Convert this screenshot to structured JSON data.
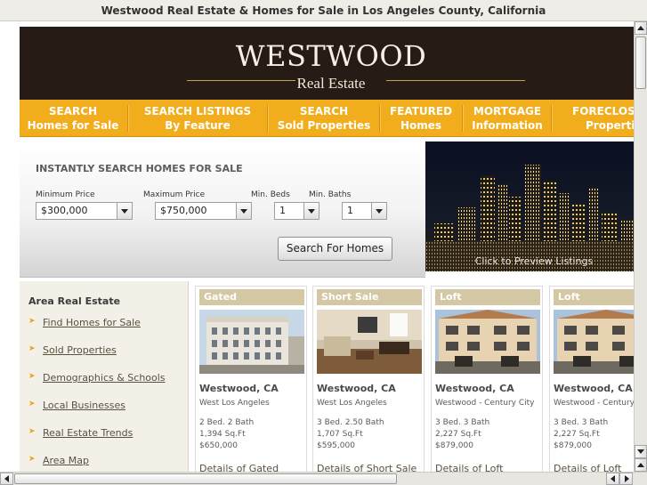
{
  "window": {
    "title": "Westwood Real Estate & Homes for Sale in Los Angeles County, California"
  },
  "header": {
    "logo_title": "WESTWOOD",
    "logo_subtitle": "Real Estate"
  },
  "nav": [
    {
      "line1": "SEARCH",
      "line2": "Homes for Sale"
    },
    {
      "line1": "SEARCH LISTINGS",
      "line2": "By Feature"
    },
    {
      "line1": "SEARCH",
      "line2": "Sold Properties"
    },
    {
      "line1": "FEATURED",
      "line2": "Homes"
    },
    {
      "line1": "MORTGAGE",
      "line2": "Information"
    },
    {
      "line1": "FORECLOSU",
      "line2": "Properties"
    }
  ],
  "search": {
    "heading": "INSTANTLY SEARCH HOMES FOR SALE",
    "min_price_label": "Minimum Price",
    "min_price_value": "$300,000",
    "max_price_label": "Maximum Price",
    "max_price_value": "$750,000",
    "beds_label": "Min. Beds",
    "beds_value": "1",
    "baths_label": "Min. Baths",
    "baths_value": "1",
    "button": "Search For Homes"
  },
  "city_photo": {
    "caption": "Click to Preview Listings"
  },
  "sidebar": {
    "heading": "Area Real Estate",
    "arrow": "➤",
    "items": [
      "Find Homes for Sale",
      "Sold Properties",
      "Demographics & Schools",
      "Local Businesses",
      "Real Estate Trends",
      "Area Map"
    ]
  },
  "listings": [
    {
      "tag": "Gated",
      "location": "Westwood, CA",
      "area": "West Los Angeles",
      "beds_baths": "2 Bed. 2 Bath",
      "sqft": "1,394 Sq.Ft",
      "price": "$650,000",
      "details": "Details of Gated"
    },
    {
      "tag": "Short Sale",
      "location": "Westwood, CA",
      "area": "West Los Angeles",
      "beds_baths": "3 Bed. 2.50 Bath",
      "sqft": "1,707 Sq.Ft",
      "price": "$595,000",
      "details": "Details of Short Sale"
    },
    {
      "tag": "Loft",
      "location": "Westwood, CA",
      "area": "Westwood - Century City",
      "beds_baths": "3 Bed. 3 Bath",
      "sqft": "2,227 Sq.Ft",
      "price": "$879,000",
      "details": "Details of Loft"
    },
    {
      "tag": "Loft",
      "location": "Westwood, CA",
      "area": "Westwood - Century City",
      "beds_baths": "3 Bed. 3 Bath",
      "sqft": "2,227 Sq.Ft",
      "price": "$879,000",
      "details": "Details of Loft"
    }
  ],
  "colors": {
    "header_bg": "#271c15",
    "nav_bg": "#f2ad1d",
    "tag_bg": "#d4c7a4",
    "accent_gold": "#c9a250"
  }
}
